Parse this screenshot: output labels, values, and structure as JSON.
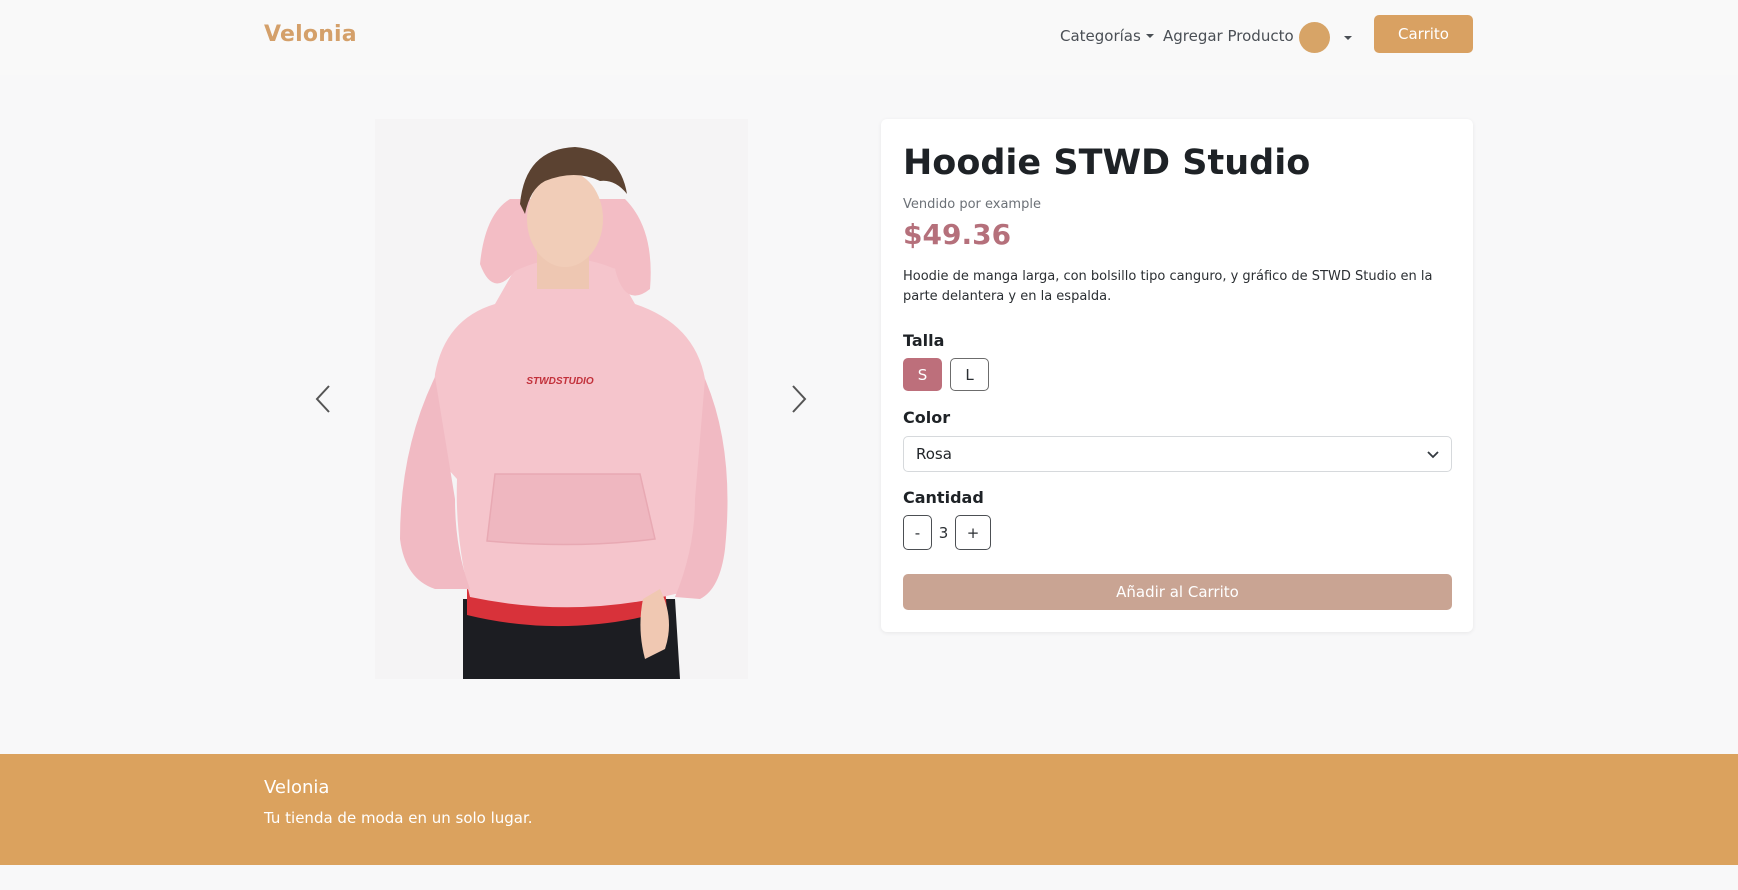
{
  "navbar": {
    "brand": "Velonia",
    "categories_label": "Categorías",
    "add_product_label": "Agregar Producto",
    "cart_label": "Carrito"
  },
  "carousel": {
    "image_alt": "Hoodie STWD Studio",
    "print_text": "STWDSTUDIO"
  },
  "product": {
    "title": "Hoodie STWD Studio",
    "seller": "Vendido por example",
    "price": "$49.36",
    "description": "Hoodie de manga larga, con bolsillo tipo canguro, y gráfico de STWD Studio en la parte delantera y en la espalda.",
    "size_label": "Talla",
    "sizes": [
      "S",
      "L"
    ],
    "selected_size": "S",
    "color_label": "Color",
    "color_value": "Rosa",
    "quantity_label": "Cantidad",
    "quantity_minus": "-",
    "quantity_value": "3",
    "quantity_plus": "+",
    "add_to_cart_label": "Añadir al Carrito"
  },
  "footer": {
    "brand": "Velonia",
    "tagline": "Tu tienda de moda en un solo lugar."
  },
  "colors": {
    "brand": "#d4a06a",
    "accent": "#d9a162",
    "price": "#b5707b",
    "selected_size": "#bd6f7b",
    "add_to_cart": "#c9a493",
    "footer": "#dba25e"
  },
  "icons": {
    "prev": "chevron-left-icon",
    "next": "chevron-right-icon",
    "select": "chevron-down-icon",
    "dropdown": "caret-down-icon"
  }
}
